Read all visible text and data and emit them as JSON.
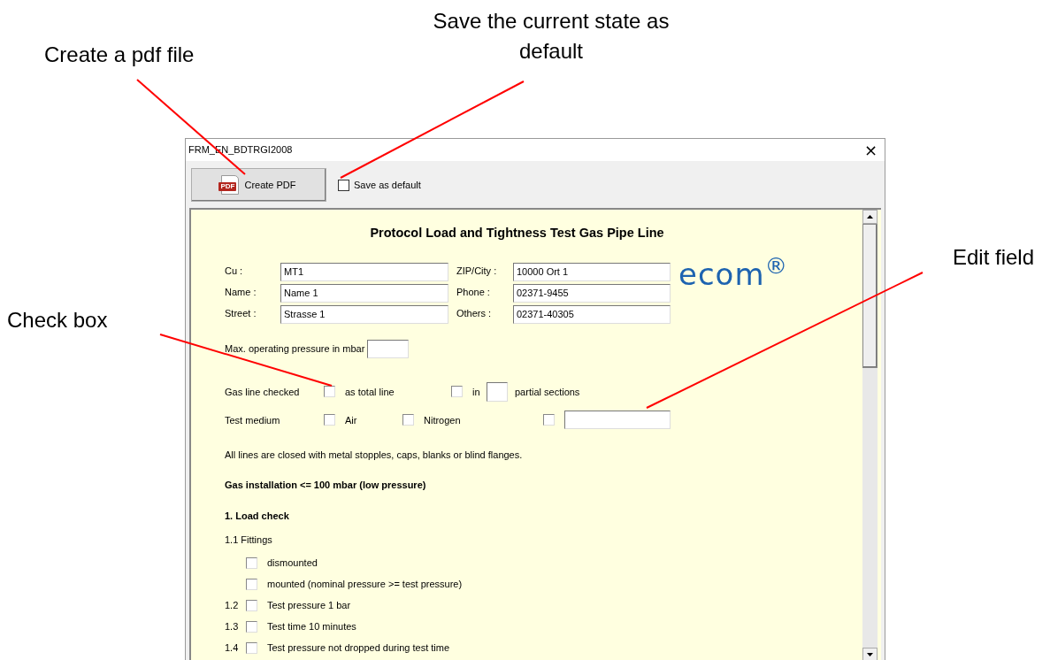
{
  "annotations": [
    {
      "text": "Create a pdf file"
    },
    {
      "text": "Save the current state as default"
    },
    {
      "text": "Edit field"
    },
    {
      "text": "Check box"
    }
  ],
  "window": {
    "title": "FRM_EN_BDTRGI2008",
    "close": "×"
  },
  "toolbar": {
    "create_pdf": {
      "icon_text": "PDF",
      "label": "Create PDF"
    },
    "save_default": {
      "label": "Save as default",
      "checked": false
    }
  },
  "form": {
    "title": "Protocol Load and Tightness Test Gas Pipe Line",
    "logo": "ecom$^{®}$",
    "contact_fields": [
      {
        "label": "Cu :",
        "value": "MT1"
      },
      {
        "label": "ZIP/City :",
        "value": "10000 Ort 1"
      },
      {
        "label": "Name :",
        "value": "Name 1"
      },
      {
        "label": "Phone :",
        "value": "02371-9455"
      },
      {
        "label": "Street :",
        "value": "Strasse 1"
      },
      {
        "label": "Others :",
        "value": "02371-40305"
      }
    ],
    "max_pressure": {
      "label": "Max. operating pressure in mbar"
    },
    "option_rows": [
      {
        "label": "Gas line checked",
        "items": [
          {
            "kind": "checkbox",
            "label": "as total line",
            "checked": false
          },
          {
            "kind": "checkbox",
            "label": "in",
            "checked": false
          },
          {
            "kind": "field"
          },
          {
            "kind": "text",
            "text": "partial sections"
          }
        ]
      },
      {
        "label": "Test medium",
        "items": [
          {
            "kind": "checkbox",
            "label": "Air",
            "checked": false
          },
          {
            "kind": "checkbox",
            "label": "Nitrogen",
            "checked": false
          },
          {
            "kind": "checkbox",
            "checked": false
          },
          {
            "kind": "field"
          }
        ]
      }
    ],
    "note": "All lines are closed with metal stopples, caps, blanks or blind flanges.",
    "section_heading": "Gas installation <= 100 mbar (low pressure)",
    "subsection_heading": "1. Load check",
    "fittings_label": "1.1 Fittings",
    "checks": [
      {
        "label": "dismounted",
        "checked": false
      },
      {
        "label": "mounted (nominal pressure >= test pressure)",
        "checked": false
      },
      {
        "number": "1.2",
        "label": "Test pressure 1 bar",
        "checked": false
      },
      {
        "number": "1.3",
        "label": "Test time 10 minutes",
        "checked": false
      },
      {
        "number": "1.4",
        "label": "Test pressure not dropped during test time",
        "checked": false
      }
    ]
  }
}
